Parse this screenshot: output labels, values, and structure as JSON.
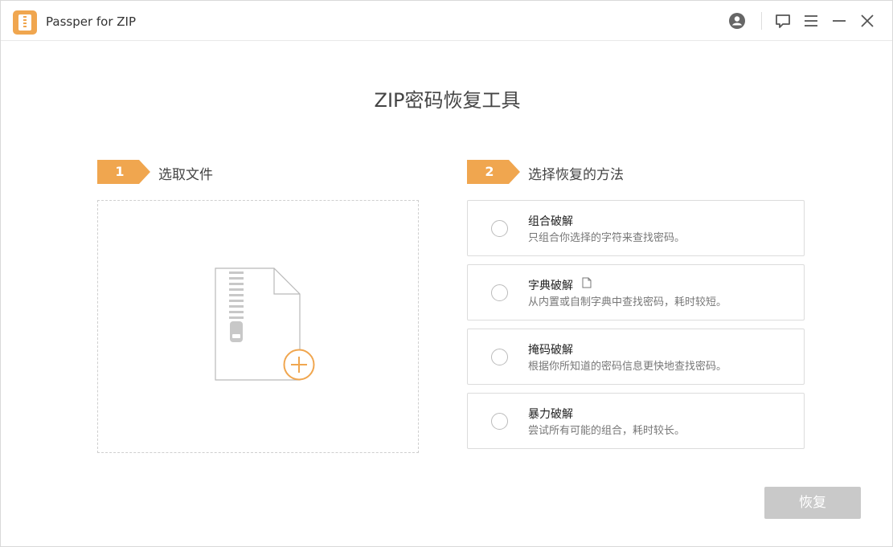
{
  "app": {
    "title": "Passper for ZIP"
  },
  "titlebar": {
    "icons": [
      "account-icon",
      "feedback-icon",
      "menu-icon",
      "minimize-icon",
      "close-icon"
    ]
  },
  "page_title": "ZIP密码恢复工具",
  "steps": [
    {
      "number": "1",
      "label": "选取文件"
    },
    {
      "number": "2",
      "label": "选择恢复的方法"
    }
  ],
  "methods": [
    {
      "title": "组合破解",
      "desc": "只组合你选择的字符来查找密码。",
      "selected": false
    },
    {
      "title": "字典破解",
      "desc": "从内置或自制字典中查找密码，耗时较短。",
      "selected": false,
      "extra_icon": "dictionary-file-icon"
    },
    {
      "title": "掩码破解",
      "desc": "根据你所知道的密码信息更快地查找密码。",
      "selected": false
    },
    {
      "title": "暴力破解",
      "desc": "尝试所有可能的组合，耗时较长。",
      "selected": false
    }
  ],
  "recover_button": "恢复",
  "colors": {
    "accent": "#f0a64f",
    "button_disabled": "#c9c9c9",
    "border": "#dcdcdc"
  }
}
